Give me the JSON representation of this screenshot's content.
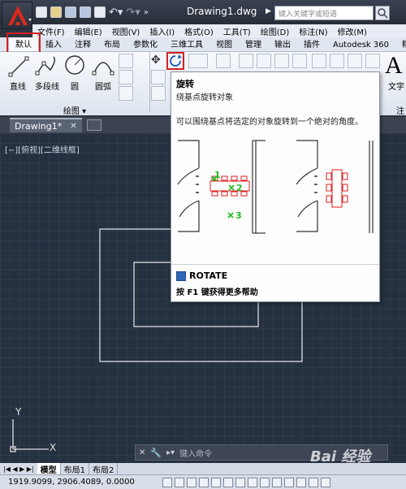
{
  "title_bar": {
    "document_title": "Drawing1.dwg",
    "search_placeholder": "键入关键字或短语"
  },
  "menu": [
    "文件(F)",
    "编辑(E)",
    "视图(V)",
    "插入(I)",
    "格式(O)",
    "工具(T)",
    "绘图(D)",
    "标注(N)",
    "修改(M)"
  ],
  "ribbon_tabs": [
    "默认",
    "插入",
    "注释",
    "布局",
    "参数化",
    "三维工具",
    "视图",
    "管理",
    "输出",
    "插件",
    "Autodesk 360",
    "精"
  ],
  "draw_tools": [
    "直线",
    "多段线",
    "圆",
    "圆弧"
  ],
  "ribbon": {
    "draw_panel_title": "绘图 ▾",
    "text_label": "文字",
    "annot_label": "注"
  },
  "doc_tab": "Drawing1*",
  "view_label": "[−][俯视][二维线框]",
  "tooltip": {
    "title": "旋转",
    "subtitle": "绕基点旋转对象",
    "description": "可以围绕基点将选定的对象旋转到一个绝对的角度。",
    "markers": [
      "1",
      "2",
      "3"
    ],
    "command": "ROTATE",
    "help": "按 F1 键获得更多帮助"
  },
  "ucs": {
    "y": "Y",
    "x": "X"
  },
  "command_line": {
    "placeholder": "键入命令"
  },
  "layout_tabs": [
    "模型",
    "布局1",
    "布局2"
  ],
  "status": {
    "coords": "1919.9099, 2906.4089, 0.0000"
  },
  "watermark": "Bai 经验",
  "colors": {
    "highlight": "#d42020",
    "marker_green": "#22bb22",
    "furniture_red": "#e02020"
  }
}
